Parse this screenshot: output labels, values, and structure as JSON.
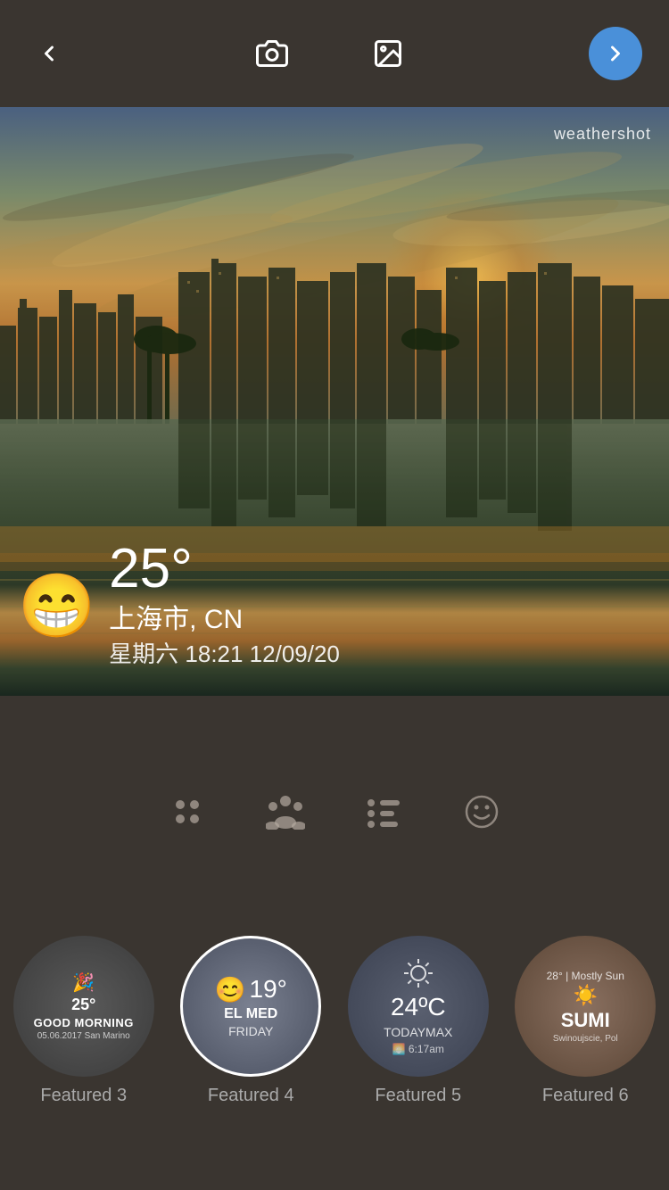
{
  "toolbar": {
    "back_label": "‹",
    "next_label": "→"
  },
  "weather": {
    "brand": "weathershot",
    "emoji": "😁",
    "temperature": "25°",
    "location": "上海市, CN",
    "day": "星期六",
    "time": "18:21",
    "date": "12/09/20",
    "full_datetime": "星期六 18:21 12/09/20"
  },
  "widgets": {
    "icon1": "⠿",
    "icon2": "⠴",
    "icon3": "☰",
    "icon4": "☺"
  },
  "featured": [
    {
      "id": "featured-3",
      "label": "Featured 3",
      "icon": "🎉",
      "temp": "25°",
      "title": "GOOD MORNING",
      "date": "05.06.2017 San Marino"
    },
    {
      "id": "featured-4",
      "label": "Featured 4",
      "emoji": "😊",
      "temp": "19°",
      "location": "EL MED",
      "day": "FRIDAY"
    },
    {
      "id": "featured-5",
      "label": "Featured 5",
      "temp": "24ºC",
      "today_label": "TODAYMAX",
      "sunrise": "🌅 6:17am"
    },
    {
      "id": "featured-6",
      "label": "Featured 6",
      "info": "28° | Mostly Sun",
      "city": "SUMI",
      "location": "Swinoujscie, Pol"
    }
  ]
}
